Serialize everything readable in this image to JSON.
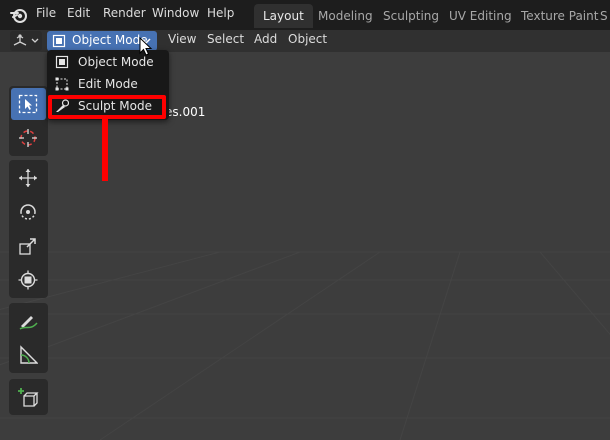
{
  "menubar": {
    "items": [
      "File",
      "Edit",
      "Render",
      "Window",
      "Help"
    ],
    "workspaces": [
      "Layout",
      "Modeling",
      "Sculpting",
      "UV Editing",
      "Texture Paint",
      "S"
    ],
    "active_workspace": "Layout"
  },
  "header": {
    "mode_label": "Object Mode",
    "menus": [
      "View",
      "Select",
      "Add",
      "Object"
    ]
  },
  "dropdown": {
    "items": [
      {
        "label": "Object Mode",
        "icon": "object-mode-icon"
      },
      {
        "label": "Edit Mode",
        "icon": "edit-mode-icon"
      },
      {
        "label": "Sculpt Mode",
        "icon": "sculpt-mode-icon"
      }
    ],
    "highlighted": "Sculpt Mode"
  },
  "viewport": {
    "object_name_fragment": "es.001"
  },
  "toolbar": {
    "tools": [
      "select-box-icon",
      "cursor-icon",
      "move-icon",
      "rotate-icon",
      "scale-icon",
      "transform-icon",
      "annotate-icon",
      "measure-icon",
      "add-cube-icon"
    ]
  },
  "colors": {
    "accent": "#4772b3",
    "highlight_annotation": "#ff0000",
    "menubar_bg": "#1d1d1d",
    "viewport_bg": "#3d3d3d"
  }
}
